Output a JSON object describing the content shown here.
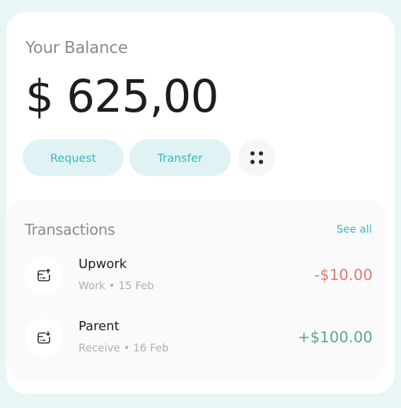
{
  "balance": {
    "label": "Your Balance",
    "amount": "$ 625,00"
  },
  "actions": {
    "request_label": "Request",
    "transfer_label": "Transfer",
    "more_icon": "grid-dots-icon"
  },
  "transactions": {
    "title": "Transactions",
    "see_all_label": "See all",
    "items": [
      {
        "name": "Upwork",
        "meta": "Work • 15 Feb",
        "amount": "-$10.00",
        "icon": "wallet-out-icon"
      },
      {
        "name": "Parent",
        "meta": "Receive • 16 Feb",
        "amount": "+$100.00",
        "icon": "wallet-in-icon"
      }
    ]
  },
  "colors": {
    "accent": "#3fb7bd",
    "accent_bg": "#dff3f5",
    "negative": "#e07a74",
    "positive": "#5aa987"
  }
}
